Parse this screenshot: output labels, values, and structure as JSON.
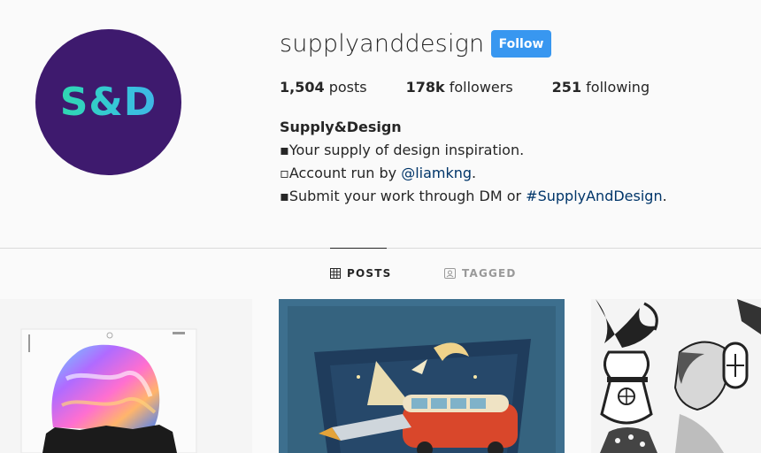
{
  "profile": {
    "avatar_text": "S&D",
    "username": "supplyanddesign",
    "follow_label": "Follow"
  },
  "stats": {
    "posts_count": "1,504",
    "posts_label": " posts",
    "followers_count": "178k",
    "followers_label": " followers",
    "following_count": "251",
    "following_label": " following"
  },
  "bio": {
    "name": "Supply&Design",
    "line1": "▪Your supply of design inspiration.",
    "line2_prefix": "▫Account run by ",
    "line2_link": "@liamkng",
    "line2_suffix": ".",
    "line3_prefix": "▪Submit your work through DM or ",
    "line3_link": "#SupplyAndDesign",
    "line3_suffix": "."
  },
  "tabs": {
    "posts": "POSTS",
    "tagged": "TAGGED"
  },
  "colors": {
    "follow_button": "#3897f0",
    "avatar_bg": "#3e1a6e",
    "link": "#003569"
  },
  "icons": [
    "grid-icon",
    "tag-icon"
  ]
}
